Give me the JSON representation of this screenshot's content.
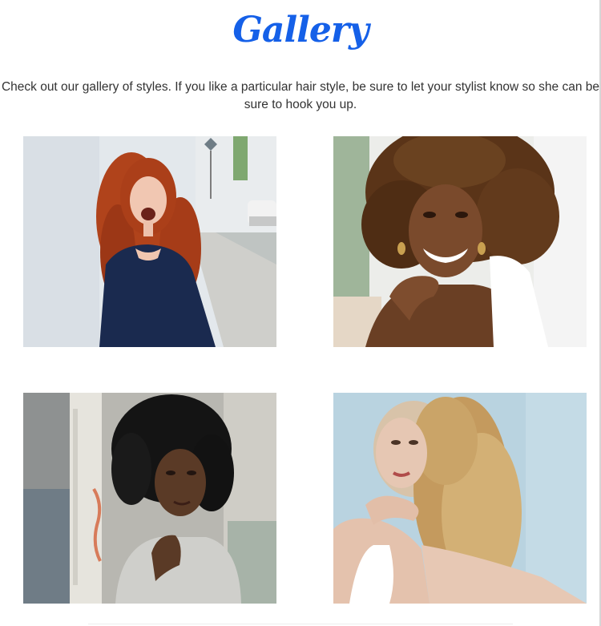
{
  "page": {
    "title": "Gallery",
    "intro": "Check out our gallery of styles. If you like a particular hair style, be sure to let your stylist know so she can be sure to hook you up."
  },
  "gallery": {
    "photos": [
      {
        "name": "curly-red-hair-photo",
        "hair_color": "#b8421a",
        "background": "#dfe5ea"
      },
      {
        "name": "curly-afro-brown-hair-photo",
        "hair_color": "#5a3418",
        "background": "#e9ebe4"
      },
      {
        "name": "black-natural-curls-photo",
        "hair_color": "#141414",
        "background": "#b9b6ae"
      },
      {
        "name": "blonde-curly-hair-photo",
        "hair_color": "#c9a36a",
        "background": "#b8d3e0"
      }
    ]
  },
  "colors": {
    "title": "#1560e8",
    "text": "#333333"
  }
}
